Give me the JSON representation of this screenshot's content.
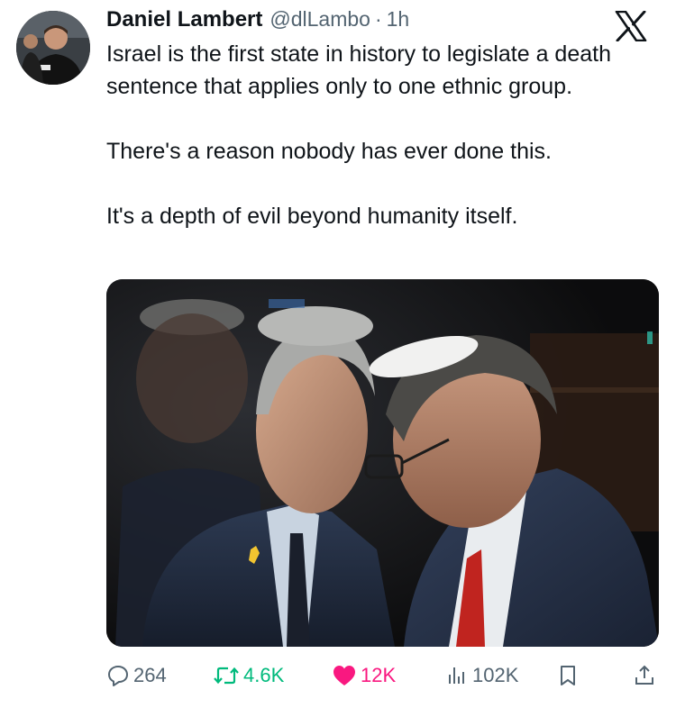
{
  "author": {
    "name": "Daniel Lambert",
    "handle": "@dlLambo",
    "separator": "·",
    "time": "1h"
  },
  "tweet": {
    "paragraphs": [
      "Israel is the first state in history to legislate a death sentence that applies only to one ethnic group.",
      "There's a reason nobody has ever done this.",
      "It's a depth of evil beyond humanity itself."
    ]
  },
  "actions": {
    "replies": "264",
    "retweets": "4.6K",
    "likes": "12K",
    "views": "102K"
  },
  "colors": {
    "text": "#0f1419",
    "secondary": "#536471",
    "retweet_active": "#00ba7c",
    "like_active": "#f91880"
  },
  "icons": [
    "x-logo-icon",
    "reply-icon",
    "retweet-icon",
    "heart-icon",
    "views-icon",
    "bookmark-icon",
    "share-icon"
  ]
}
